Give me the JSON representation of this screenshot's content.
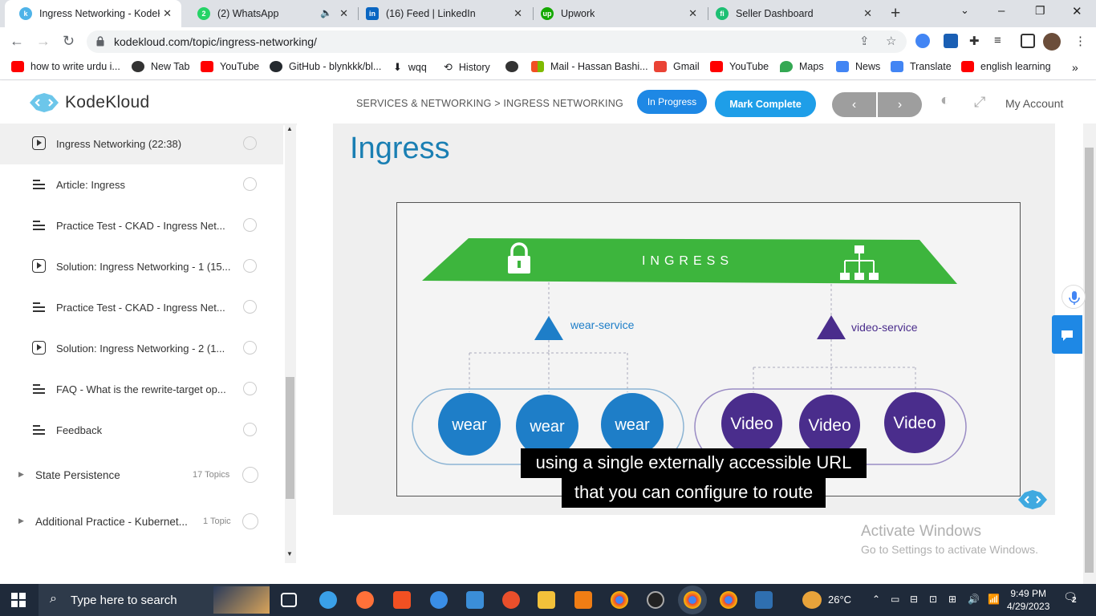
{
  "tabs": [
    {
      "title": "Ingress Networking - KodeKl",
      "fav_color": "#4fb3e8",
      "fav": "k"
    },
    {
      "title": "(2) WhatsApp",
      "fav_color": "#25d366",
      "fav": "2"
    },
    {
      "title": "(16) Feed | LinkedIn",
      "fav_color": "#0a66c2",
      "fav": "in"
    },
    {
      "title": "Upwork",
      "fav_color": "#14a800",
      "fav": "up"
    },
    {
      "title": "Seller Dashboard",
      "fav_color": "#1dbf73",
      "fav": "fi"
    }
  ],
  "url": "kodekloud.com/topic/ingress-networking/",
  "bookmarks": [
    {
      "label": "how to write urdu i...",
      "color": "#ff0000"
    },
    {
      "label": "New Tab",
      "color": "#333333"
    },
    {
      "label": "YouTube",
      "color": "#ff0000"
    },
    {
      "label": "GitHub - blynkkk/bl...",
      "color": "#24292e"
    },
    {
      "label": "wqq",
      "color": "#555555"
    },
    {
      "label": "History",
      "color": "#555555"
    },
    {
      "label": "",
      "color": "#333333"
    },
    {
      "label": "Mail - Hassan Bashi...",
      "color": "#f25022"
    },
    {
      "label": "Gmail",
      "color": "#ea4335"
    },
    {
      "label": "YouTube",
      "color": "#ff0000"
    },
    {
      "label": "Maps",
      "color": "#34a853"
    },
    {
      "label": "News",
      "color": "#4285f4"
    },
    {
      "label": "Translate",
      "color": "#4285f4"
    },
    {
      "label": "english learning",
      "color": "#ff0000"
    }
  ],
  "header": {
    "logo": "KodeKloud",
    "breadcrumb": "SERVICES & NETWORKING > INGRESS NETWORKING",
    "status_btn": "In Progress",
    "mark_btn": "Mark Complete",
    "prev": "‹",
    "next": "›",
    "account": "My Account"
  },
  "sidebar": {
    "items": [
      {
        "label": "Ingress Networking (22:38)",
        "type": "video"
      },
      {
        "label": "Article: Ingress",
        "type": "doc"
      },
      {
        "label": "Practice Test - CKAD - Ingress Net...",
        "type": "doc"
      },
      {
        "label": "Solution: Ingress Networking - 1 (15...",
        "type": "video"
      },
      {
        "label": "Practice Test - CKAD - Ingress Net...",
        "type": "doc"
      },
      {
        "label": "Solution: Ingress Networking - 2 (1...",
        "type": "video"
      },
      {
        "label": "FAQ - What is the rewrite-target op...",
        "type": "doc"
      },
      {
        "label": "Feedback",
        "type": "doc"
      }
    ],
    "sections": [
      {
        "label": "State Persistence",
        "count": "17 Topics"
      },
      {
        "label": "Additional Practice - Kubernet...",
        "count": "1 Topic"
      }
    ]
  },
  "slide": {
    "title": "Ingress",
    "ingress_label": "INGRESS",
    "wear_service": "wear-service",
    "video_service": "video-service",
    "wear_pods": [
      "wear",
      "wear",
      "wear"
    ],
    "video_pods": [
      "Video",
      "Video",
      "Video"
    ]
  },
  "subtitles": [
    "using a single externally accessible URL",
    "that you can configure to route"
  ],
  "watermark": {
    "line1": "Activate Windows",
    "line2": "Go to Settings to activate Windows."
  },
  "taskbar": {
    "search_placeholder": "Type here to search",
    "temp": "26°C",
    "time": "9:49 PM",
    "date": "4/29/2023",
    "notif_count": "2"
  },
  "colors": {
    "accent": "#1e88e5",
    "ingress_green": "#3db53d",
    "wear_blue": "#1e7ec8",
    "video_purple": "#4a2d8c"
  }
}
